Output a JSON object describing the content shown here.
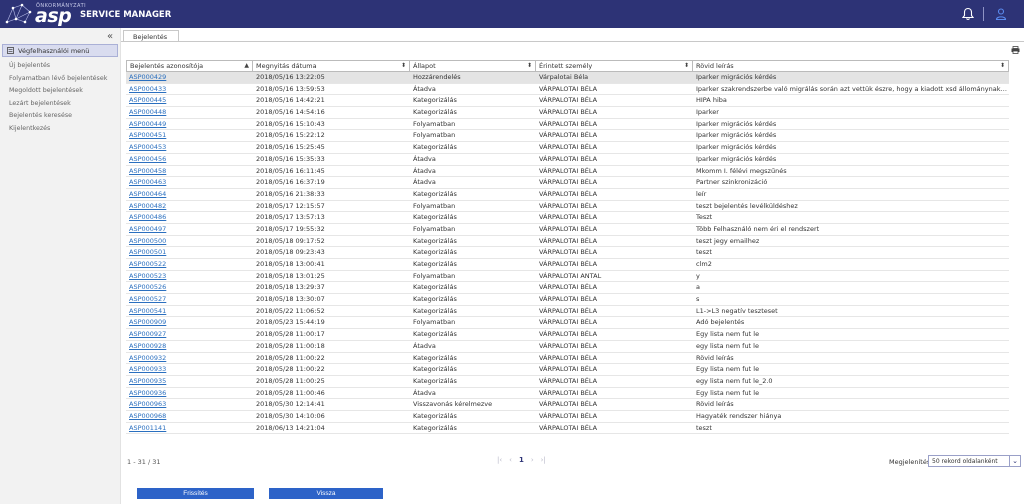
{
  "header": {
    "brand_small": "ÖNKORMÁNYZATI",
    "brand_logo": "asp",
    "app_title": "SERVICE MANAGER",
    "icons": [
      "bell-icon",
      "user-icon"
    ]
  },
  "sidebar": {
    "collapse_icon": "double-chevron-left-icon",
    "menu_title": "Végfelhasználói menü",
    "items": [
      {
        "label": "Új bejelentés"
      },
      {
        "label": "Folyamatban lévő bejelentések"
      },
      {
        "label": "Megoldott bejelentések"
      },
      {
        "label": "Lezárt bejelentések"
      },
      {
        "label": "Bejelentés keresése"
      },
      {
        "label": "Kijelentkezés"
      }
    ]
  },
  "tabs": [
    {
      "label": "Bejelentés"
    }
  ],
  "table": {
    "columns": [
      {
        "label": "Bejelentés azonosítója",
        "sort": "asc"
      },
      {
        "label": "Megnyitás dátuma",
        "sort": "both"
      },
      {
        "label": "Állapot",
        "sort": "both"
      },
      {
        "label": "Érintett személy",
        "sort": "both"
      },
      {
        "label": "Rövid leírás",
        "sort": "both"
      }
    ],
    "rows": [
      [
        "ASP000429",
        "2018/05/16 13:22:05",
        "Hozzárendelés",
        "Várpalotai Béla",
        "Iparker migrációs kérdés"
      ],
      [
        "ASP000433",
        "2018/05/16 13:59:53",
        "Átadva",
        "VÁRPALOTAI BÉLA",
        "Iparker szakrendszerbe való migrálás során azt vettük észre, hogy a kiadott xsd állománynak megf..."
      ],
      [
        "ASP000445",
        "2018/05/16 14:42:21",
        "Kategorizálás",
        "VÁRPALOTAI BÉLA",
        "HIPA hiba"
      ],
      [
        "ASP000448",
        "2018/05/16 14:54:16",
        "Kategorizálás",
        "VÁRPALOTAI BÉLA",
        "Iparker"
      ],
      [
        "ASP000449",
        "2018/05/16 15:10:43",
        "Folyamatban",
        "VÁRPALOTAI BÉLA",
        "Iparker migrációs kérdés"
      ],
      [
        "ASP000451",
        "2018/05/16 15:22:12",
        "Folyamatban",
        "VÁRPALOTAI BÉLA",
        "Iparker migrációs kérdés"
      ],
      [
        "ASP000453",
        "2018/05/16 15:25:45",
        "Kategorizálás",
        "VÁRPALOTAI BÉLA",
        "Iparker migrációs kérdés"
      ],
      [
        "ASP000456",
        "2018/05/16 15:35:33",
        "Átadva",
        "VÁRPALOTAI BÉLA",
        "Iparker migrációs kérdés"
      ],
      [
        "ASP000458",
        "2018/05/16 16:11:45",
        "Átadva",
        "VÁRPALOTAI BÉLA",
        "Mkomm I. félévi megszűnés"
      ],
      [
        "ASP000463",
        "2018/05/16 16:37:19",
        "Átadva",
        "VÁRPALOTAI BÉLA",
        "Partner szinkronizáció"
      ],
      [
        "ASP000464",
        "2018/05/16 21:38:33",
        "Kategorizálás",
        "VÁRPALOTAI BÉLA",
        "leír"
      ],
      [
        "ASP000482",
        "2018/05/17 12:15:57",
        "Folyamatban",
        "VÁRPALOTAI BÉLA",
        "teszt bejelentés levélküldéshez"
      ],
      [
        "ASP000486",
        "2018/05/17 13:57:13",
        "Kategorizálás",
        "VÁRPALOTAI BÉLA",
        "Teszt"
      ],
      [
        "ASP000497",
        "2018/05/17 19:55:32",
        "Folyamatban",
        "VÁRPALOTAI BÉLA",
        "Több Felhasználó nem éri el rendszert"
      ],
      [
        "ASP000500",
        "2018/05/18 09:17:52",
        "Kategorizálás",
        "VÁRPALOTAI BÉLA",
        "teszt jegy emailhez"
      ],
      [
        "ASP000501",
        "2018/05/18 09:23:43",
        "Kategorizálás",
        "VÁRPALOTAI BÉLA",
        "teszt"
      ],
      [
        "ASP000522",
        "2018/05/18 13:00:41",
        "Kategorizálás",
        "VÁRPALOTAI BÉLA",
        "clm2"
      ],
      [
        "ASP000523",
        "2018/05/18 13:01:25",
        "Folyamatban",
        "VÁRPALOTAI ANTAL",
        "y"
      ],
      [
        "ASP000526",
        "2018/05/18 13:29:37",
        "Kategorizálás",
        "VÁRPALOTAI BÉLA",
        "a"
      ],
      [
        "ASP000527",
        "2018/05/18 13:30:07",
        "Kategorizálás",
        "VÁRPALOTAI BÉLA",
        "s"
      ],
      [
        "ASP000541",
        "2018/05/22 11:06:52",
        "Kategorizálás",
        "VÁRPALOTAI BÉLA",
        "L1->L3 negatív teszteset"
      ],
      [
        "ASP000909",
        "2018/05/23 15:44:19",
        "Folyamatban",
        "VÁRPALOTAI BÉLA",
        "Adó bejelentés"
      ],
      [
        "ASP000927",
        "2018/05/28 11:00:17",
        "Kategorizálás",
        "VÁRPALOTAI BÉLA",
        "Egy lista nem fut le"
      ],
      [
        "ASP000928",
        "2018/05/28 11:00:18",
        "Átadva",
        "VÁRPALOTAI BÉLA",
        "egy lista nem fut le"
      ],
      [
        "ASP000932",
        "2018/05/28 11:00:22",
        "Kategorizálás",
        "VÁRPALOTAI BÉLA",
        "Rövid leírás"
      ],
      [
        "ASP000933",
        "2018/05/28 11:00:22",
        "Kategorizálás",
        "VÁRPALOTAI BÉLA",
        "Egy lista nem fut le"
      ],
      [
        "ASP000935",
        "2018/05/28 11:00:25",
        "Kategorizálás",
        "VÁRPALOTAI BÉLA",
        "egy lista nem fut le_2.0"
      ],
      [
        "ASP000936",
        "2018/05/28 11:00:46",
        "Átadva",
        "VÁRPALOTAI BÉLA",
        "Egy lista nem fut le"
      ],
      [
        "ASP000963",
        "2018/05/30 12:14:41",
        "Visszavonás kérelmezve",
        "VÁRPALOTAI BÉLA",
        "Rövid leírás"
      ],
      [
        "ASP000968",
        "2018/05/30 14:10:06",
        "Kategorizálás",
        "VÁRPALOTAI BÉLA",
        "Hagyaték rendszer hiánya"
      ],
      [
        "ASP001141",
        "2018/06/13 14:21:04",
        "Kategorizálás",
        "VÁRPALOTAI BÉLA",
        "teszt"
      ]
    ]
  },
  "pager": {
    "count": "1 - 31 / 31",
    "current_page": "1",
    "per_page_label": "Megjelenítés",
    "per_page_value": "50 rekord oldalanként"
  },
  "buttons": {
    "refresh": "Frissítés",
    "back": "Vissza"
  },
  "colors": {
    "header_bg": "#2d3376",
    "button_bg": "#2d63c8",
    "link": "#2a6fbf"
  }
}
